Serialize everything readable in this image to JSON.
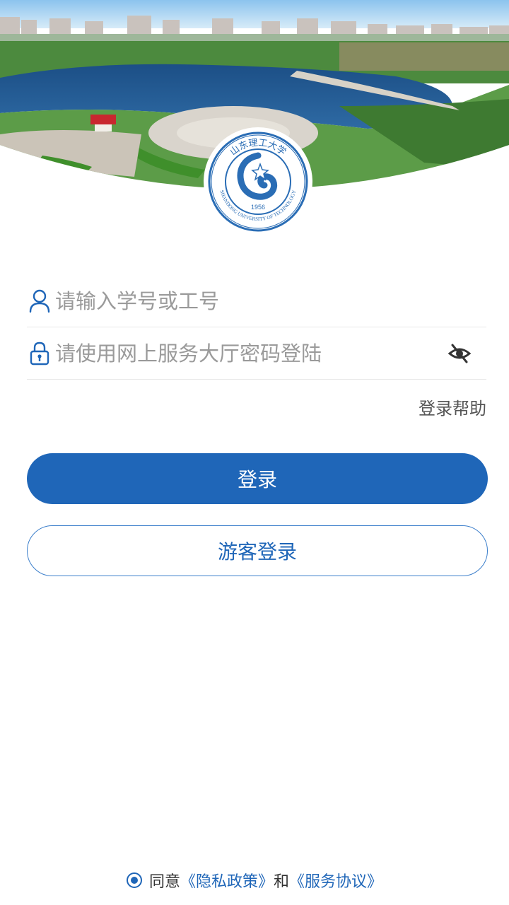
{
  "header": {
    "logo": {
      "text_top": "山东理工大学",
      "text_bottom": "SHANDONG UNIVERSITY OF TECHNOLOGY",
      "year": "1956"
    }
  },
  "form": {
    "username_placeholder": "请输入学号或工号",
    "password_placeholder": "请使用网上服务大厅密码登陆",
    "help_label": "登录帮助"
  },
  "buttons": {
    "login_label": "登录",
    "guest_label": "游客登录"
  },
  "agreement": {
    "prefix": "同意",
    "privacy_link": "《隐私政策》",
    "conjunction": "和",
    "service_link": "《服务协议》"
  },
  "colors": {
    "primary": "#1f66b8",
    "placeholder": "#9a9a9a"
  }
}
